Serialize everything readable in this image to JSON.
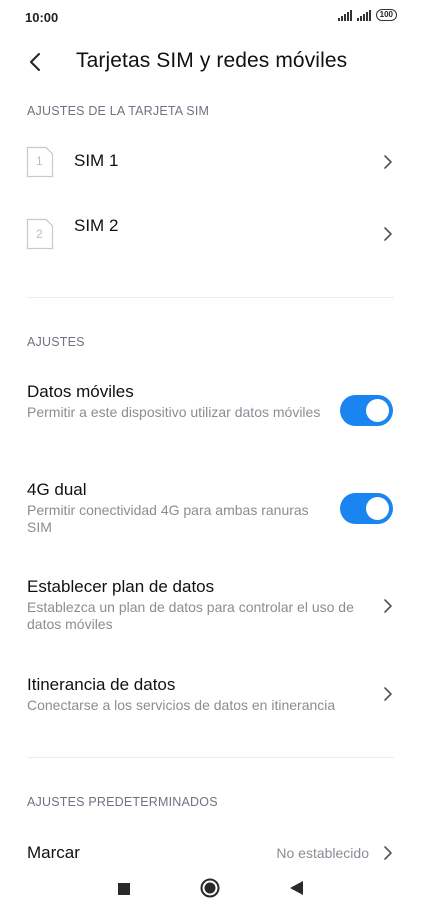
{
  "status_bar": {
    "time": "10:00",
    "battery": "100"
  },
  "header": {
    "title": "Tarjetas SIM y redes móviles"
  },
  "sim_section": {
    "header": "AJUSTES DE LA TARJETA SIM",
    "items": [
      {
        "label": "SIM 1",
        "icon_number": "1"
      },
      {
        "label": "SIM 2",
        "icon_number": "2"
      }
    ]
  },
  "settings_section": {
    "header": "AJUSTES",
    "mobile_data": {
      "title": "Datos móviles",
      "subtitle": "Permitir a este dispositivo utilizar datos móviles",
      "enabled": true
    },
    "dual_4g": {
      "title": "4G dual",
      "subtitle": "Permitir conectividad 4G para ambas ranuras SIM",
      "enabled": true
    },
    "data_plan": {
      "title": "Establecer plan de datos",
      "subtitle": "Establezca un plan de datos para controlar el uso de datos móviles"
    },
    "roaming": {
      "title": "Itinerancia de datos",
      "subtitle": "Conectarse a los servicios de datos en itinerancia"
    }
  },
  "defaults_section": {
    "header": "AJUSTES PREDETERMINADOS",
    "dial": {
      "title": "Marcar",
      "value": "No establecido"
    }
  },
  "colors": {
    "accent": "#1a84f0",
    "secondary_text": "#8a8d94",
    "section_header": "#6e7381"
  }
}
